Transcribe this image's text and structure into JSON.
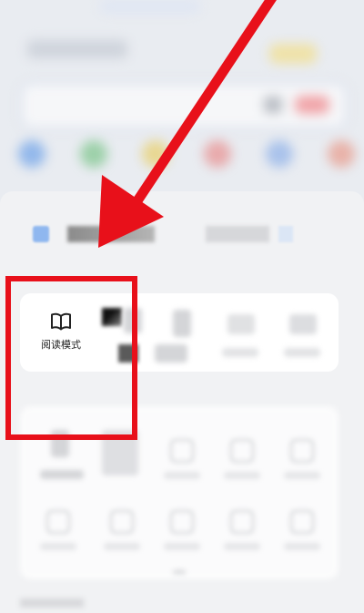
{
  "reading_mode": {
    "label": "阅读模式",
    "icon": "book-open-icon"
  },
  "colors": {
    "annotation_red": "#e8101a",
    "sheet_bg": "#f1f2f4",
    "card_bg": "#ffffff",
    "backdrop": "#e9ecf1"
  }
}
